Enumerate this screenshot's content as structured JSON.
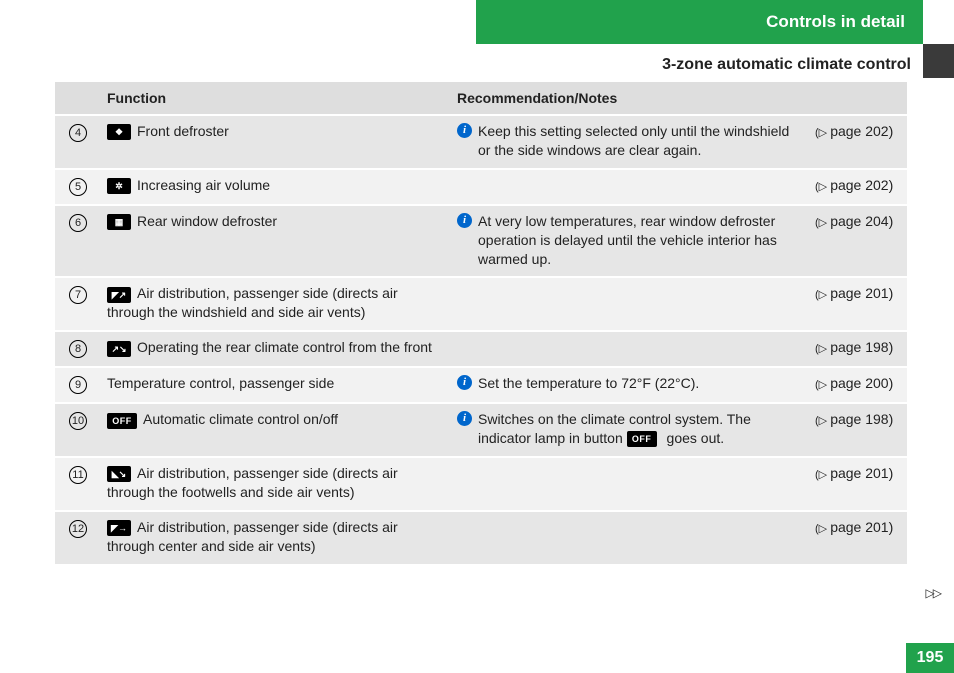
{
  "header": {
    "tab": "Controls in detail",
    "subtitle": "3-zone automatic climate control"
  },
  "columns": {
    "func": "Function",
    "rec": "Recommendation/Notes"
  },
  "rows": [
    {
      "num": "4",
      "icon": "defrost-front-icon",
      "iconGlyph": "❖",
      "function": "Front defroster",
      "recommendation": "Keep this setting selected only until the windshield or the side windows are clear again.",
      "info": true,
      "page": "202"
    },
    {
      "num": "5",
      "icon": "fan-icon",
      "iconGlyph": "✲",
      "function": "Increasing air volume",
      "recommendation": "",
      "info": false,
      "page": "202"
    },
    {
      "num": "6",
      "icon": "defrost-rear-icon",
      "iconGlyph": "▦",
      "function": "Rear window defroster",
      "recommendation": "At very low temperatures, rear window defroster operation is delayed until the vehicle interior has warmed up.",
      "info": true,
      "page": "204"
    },
    {
      "num": "7",
      "icon": "air-dist-windshield-icon",
      "iconGlyph": "◤↗",
      "function": "Air distribution, passenger side (directs air through the windshield and side air vents)",
      "recommendation": "",
      "info": false,
      "page": "201"
    },
    {
      "num": "8",
      "icon": "rear-from-front-icon",
      "iconGlyph": "↗↘",
      "function": "Operating the rear climate control from the front",
      "recommendation": "",
      "info": false,
      "page": "198"
    },
    {
      "num": "9",
      "icon": "",
      "iconGlyph": "",
      "function": "Temperature control, passenger side",
      "recommendation": "Set the temperature to 72°F (22°C).",
      "info": true,
      "page": "200"
    },
    {
      "num": "10",
      "icon": "off-icon",
      "iconGlyph": "OFF",
      "function": "Automatic climate control on/off",
      "recommendation_pre": "Switches on the climate control system. The indicator lamp in button",
      "recommendation_post": "goes out.",
      "inlineIcon": "OFF",
      "info": true,
      "page": "198"
    },
    {
      "num": "11",
      "icon": "air-dist-footwell-icon",
      "iconGlyph": "◣↘",
      "function": "Air distribution, passenger side (directs air through the footwells and side air vents)",
      "recommendation": "",
      "info": false,
      "page": "201"
    },
    {
      "num": "12",
      "icon": "air-dist-center-icon",
      "iconGlyph": "◤→",
      "function": "Air distribution, passenger side (directs air through center and side air vents)",
      "recommendation": "",
      "info": false,
      "page": "201"
    }
  ],
  "footer": {
    "continue": "▷▷",
    "pageNumber": "195"
  },
  "glyphs": {
    "info": "i",
    "pageTri": "▷"
  }
}
